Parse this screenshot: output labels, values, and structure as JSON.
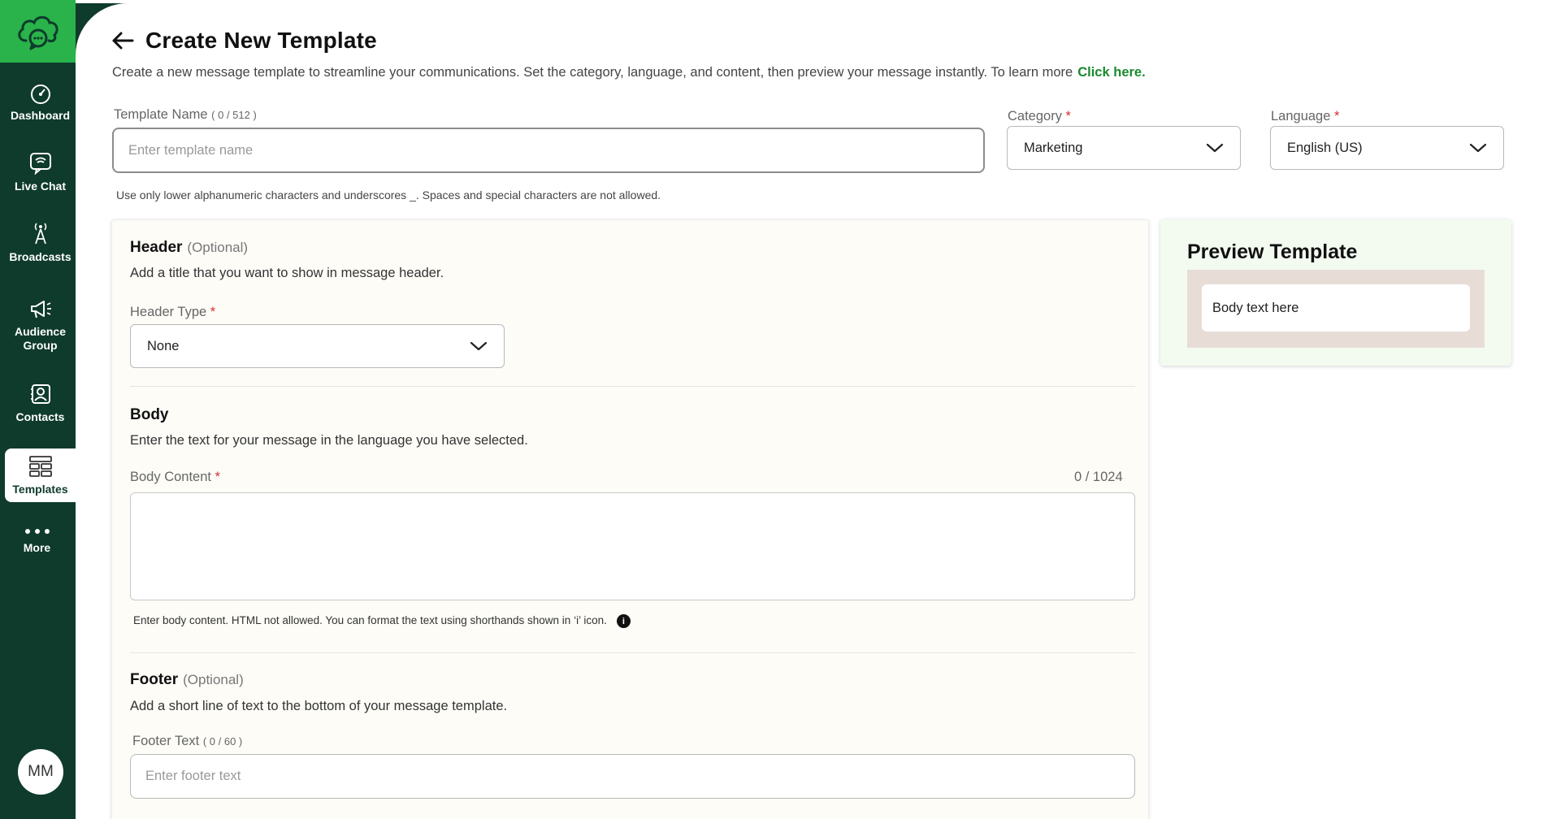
{
  "sidebar": {
    "items": [
      {
        "label": "Dashboard",
        "icon": "dashboard-icon"
      },
      {
        "label": "Live Chat",
        "icon": "live-chat-icon"
      },
      {
        "label": "Broadcasts",
        "icon": "broadcast-tower-icon"
      },
      {
        "label": "Audience Group",
        "icon": "megaphone-icon"
      },
      {
        "label": "Contacts",
        "icon": "contacts-icon"
      },
      {
        "label": "Templates",
        "icon": "templates-icon",
        "active": true
      },
      {
        "label": "More",
        "icon": "more-dots-icon"
      }
    ],
    "avatar_initials": "MM"
  },
  "page": {
    "title": "Create New Template",
    "subtitle": "Create a new message template to streamline your communications. Set the category, language, and content, then preview your message instantly. To learn more",
    "subtitle_link": "Click here."
  },
  "template_name": {
    "label": "Template Name",
    "count": "( 0 / 512 )",
    "placeholder": "Enter template name",
    "hint": "Use only lower alphanumeric characters and underscores _. Spaces and special characters are not allowed."
  },
  "category": {
    "label": "Category",
    "required_mark": "*",
    "value": "Marketing"
  },
  "language": {
    "label": "Language",
    "required_mark": "*",
    "value": "English (US)"
  },
  "header_section": {
    "title": "Header",
    "optional": "(Optional)",
    "description": "Add a title that you want to show in message header.",
    "type_label": "Header Type",
    "required_mark": "*",
    "type_value": "None"
  },
  "body_section": {
    "title": "Body",
    "description": "Enter the text for your message in the language you have selected.",
    "content_label": "Body Content",
    "required_mark": "*",
    "counter": "0 / 1024",
    "hint": "Enter body content. HTML not allowed. You can format the text using shorthands shown in ‘i’ icon."
  },
  "footer_section": {
    "title": "Footer",
    "optional": "(Optional)",
    "description": "Add a short line of text to the bottom of your message template.",
    "text_label": "Footer Text",
    "count": "( 0 / 60 )",
    "placeholder": "Enter footer text"
  },
  "preview": {
    "title": "Preview Template",
    "body_placeholder": "Body text here"
  },
  "colors": {
    "sidebar": "#0f3b2c",
    "brand_green": "#29b34a",
    "link_green": "#1a8a2f",
    "required_red": "#d32f2f"
  }
}
